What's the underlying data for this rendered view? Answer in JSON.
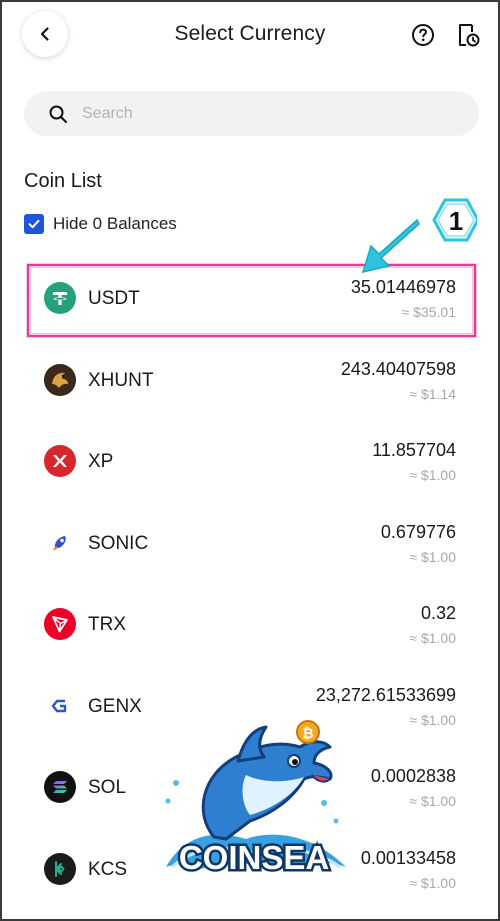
{
  "header": {
    "title": "Select Currency",
    "back_icon": "chevron-left-icon",
    "help_icon": "question-circle-icon",
    "history_icon": "document-clock-icon"
  },
  "search": {
    "placeholder": "Search",
    "value": ""
  },
  "coin_list": {
    "title": "Coin List",
    "hide_zero_label": "Hide 0 Balances",
    "hide_zero_checked": true,
    "items": [
      {
        "symbol": "USDT",
        "amount": "35.01446978",
        "usd": "≈ $35.01",
        "logo_color": "#26a17b"
      },
      {
        "symbol": "XHUNT",
        "amount": "243.40407598",
        "usd": "≈ $1.14",
        "logo_color": "#2b2118"
      },
      {
        "symbol": "XP",
        "amount": "11.857704",
        "usd": "≈ $1.00",
        "logo_color": "#d8262d"
      },
      {
        "symbol": "SONIC",
        "amount": "0.679776",
        "usd": "≈ $1.00",
        "logo_color": "#2d4fd6"
      },
      {
        "symbol": "TRX",
        "amount": "0.32",
        "usd": "≈ $1.00",
        "logo_color": "#eb0029"
      },
      {
        "symbol": "GENX",
        "amount": "23,272.61533699",
        "usd": "≈ $1.00",
        "logo_color": "#2a54c8"
      },
      {
        "symbol": "SOL",
        "amount": "0.0002838",
        "usd": "≈ $1.00",
        "logo_color": "#111111"
      },
      {
        "symbol": "KCS",
        "amount": "0.00133458",
        "usd": "≈ $1.00",
        "logo_color": "#1b1b1b"
      }
    ]
  },
  "annotation": {
    "step_number": "1",
    "highlight_color": "#e33d96",
    "arrow_color": "#2fc3dc"
  },
  "watermark": {
    "text": "COINSEA"
  },
  "colors": {
    "accent": "#1f56d8",
    "muted": "#a8a8a8"
  }
}
